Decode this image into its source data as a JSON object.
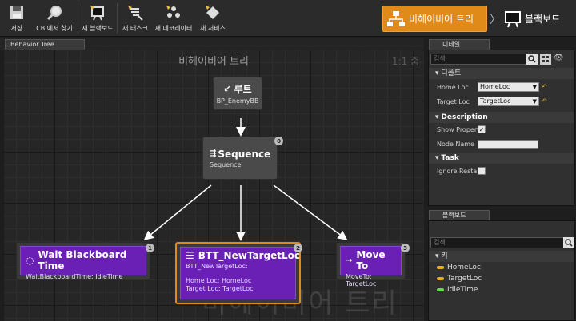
{
  "toolbar": {
    "buttons": [
      {
        "label": "저장",
        "icon": "save-icon"
      },
      {
        "label": "CB 에서 찾기",
        "icon": "magnifier-icon"
      },
      {
        "label": "새 블랙보드",
        "icon": "new-blackboard-icon"
      },
      {
        "label": "새 태스크",
        "icon": "new-task-icon"
      },
      {
        "label": "새 데코레이터",
        "icon": "new-decorator-icon"
      },
      {
        "label": "새 서비스",
        "icon": "new-service-icon"
      }
    ]
  },
  "modes": {
    "behavior_tree": "비헤이비어 트리",
    "blackboard": "블랙보드"
  },
  "graph": {
    "tab_label": "Behavior Tree",
    "title": "비헤이비어 트리",
    "zoom": "1:1 줌",
    "watermark": "비헤이비어 트리"
  },
  "nodes": {
    "root": {
      "title": "루트",
      "subtitle": "BP_EnemyBB"
    },
    "sequence": {
      "title": "Sequence",
      "subtitle": "Sequence",
      "badge": "0"
    },
    "wait": {
      "title": "Wait Blackboard Time",
      "line1": "WaitBlackboardTime: IdleTime",
      "badge": "1"
    },
    "btt": {
      "title": "BTT_NewTargetLoc",
      "line1": "BTT_NewTargetLoc:",
      "line2": "Home Loc: HomeLoc",
      "line3": "Target Loc: TargetLoc",
      "badge": "2"
    },
    "moveto": {
      "title": "Move To",
      "line1": "MoveTo: TargetLoc",
      "badge": "3"
    }
  },
  "details": {
    "tab_label": "디테일",
    "search_placeholder": "검색",
    "default_section": "디폴트",
    "home_loc_label": "Home Loc",
    "home_loc_value": "HomeLoc",
    "target_loc_label": "Target Loc",
    "target_loc_value": "TargetLoc",
    "description_section": "Description",
    "show_property_label": "Show Propert",
    "show_property_checked": true,
    "node_name_label": "Node Name",
    "node_name_value": "",
    "task_section": "Task",
    "ignore_restart_label": "Ignore Restar",
    "ignore_restart_checked": false
  },
  "blackboard": {
    "tab_label": "블랙보드",
    "search_placeholder": "검색",
    "key_section": "키",
    "keys": [
      {
        "name": "HomeLoc",
        "color": "#e0b020"
      },
      {
        "name": "TargetLoc",
        "color": "#e0b020"
      },
      {
        "name": "IdleTime",
        "color": "#60e040"
      }
    ]
  },
  "colors": {
    "accent": "#e08a1a",
    "task_purple": "#6a1fb5",
    "composite_gray": "#4a4a4a"
  }
}
